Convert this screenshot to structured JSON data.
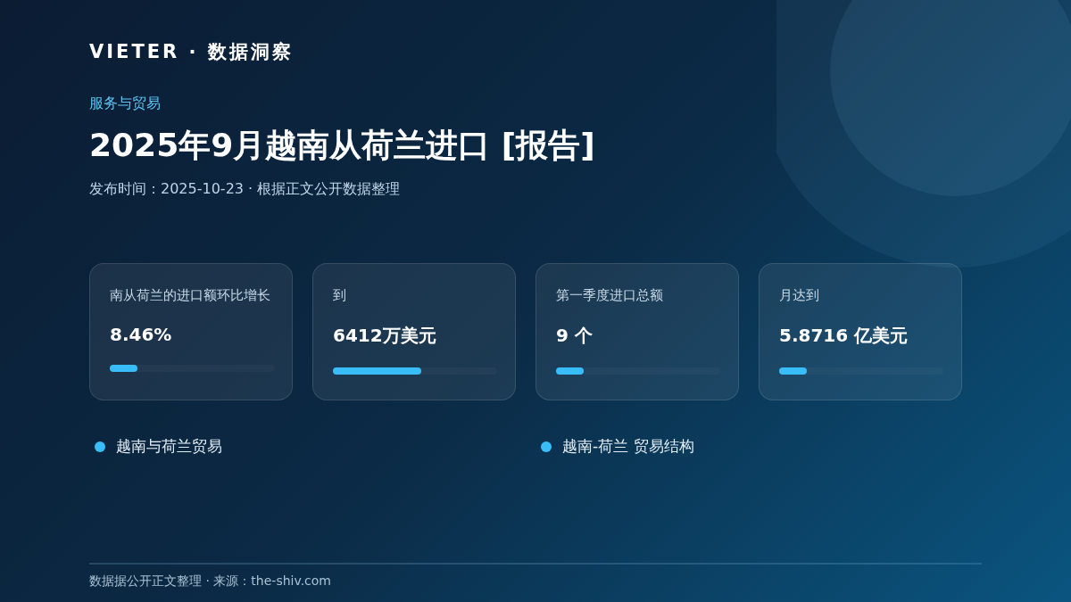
{
  "brand": "VIETER · 数据洞察",
  "category": "服务与贸易",
  "title": "2025年9月越南从荷兰进口 [报告]",
  "subtitle": "发布时间：2025-10-23 · 根据正文公开数据整理",
  "stats": [
    {
      "label": "南从荷兰的进口额环比增长",
      "value": "8.46%",
      "level": 0.17
    },
    {
      "label": "到",
      "value": "6412万美元",
      "level": 0.54
    },
    {
      "label": "第一季度进口总额",
      "value": "9 个",
      "level": 0.17
    },
    {
      "label": "月达到",
      "value": "5.8716 亿美元",
      "level": 0.17
    }
  ],
  "sections": [
    "越南与荷兰贸易",
    "越南-荷兰 贸易结构"
  ],
  "footer": "数据据公开正文整理 · 来源：the-shiv.com"
}
